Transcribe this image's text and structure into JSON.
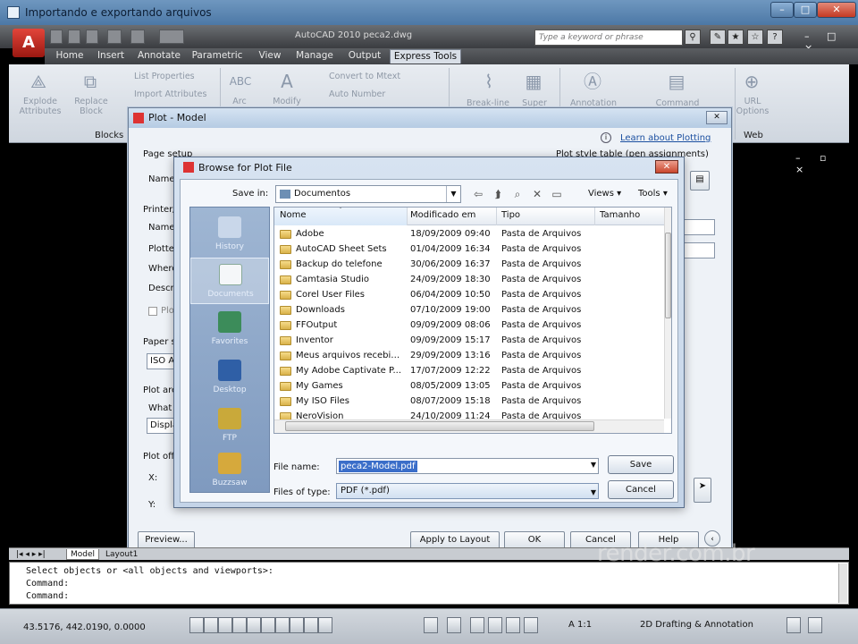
{
  "window": {
    "title": "Importando e exportando arquivos",
    "minimize": "–",
    "maximize": "□",
    "close": "✕"
  },
  "autocad": {
    "logo": "A",
    "title": "AutoCAD 2010    peca2.dwg",
    "search_placeholder": "Type a keyword or phrase",
    "window_controls": "– □ ×",
    "ribbon_tabs": [
      "Home",
      "Insert",
      "Annotate",
      "Parametric",
      "View",
      "Manage",
      "Output",
      "Express Tools"
    ],
    "active_tab": "Express Tools",
    "ribbon": {
      "explode": "Explode\nAttributes",
      "replace": "Replace\nBlock",
      "list_properties": "List Properties",
      "import_attributes": "Import Attributes",
      "arc": "Arc",
      "modify": "Modify",
      "convert_to_mtext": "Convert to Mtext",
      "auto_number": "Auto Number",
      "break_line": "Break-line",
      "super": "Super",
      "annotation": "Annotation",
      "command": "Command",
      "url_options": "URL\nOptions",
      "group_blocks": "Blocks",
      "group_web": "Web"
    },
    "doc_controls": "– ▫ ×",
    "layout_tabs": [
      "Model",
      "Layout1"
    ],
    "command_lines": [
      "Select objects or <all objects and viewports>:",
      "Command:",
      "Command:"
    ],
    "coords": "43.5176,  442.0190, 0.0000",
    "annotation_scale": "A 1:1",
    "workspace": "2D Drafting & Annotation"
  },
  "plot_dialog": {
    "title": "Plot - Model",
    "learn_link": "Learn about Plotting",
    "page_setup": "Page setup",
    "name_label": "Name:",
    "printer_label": "Printer/",
    "plotter_label": "Plotter",
    "where_label": "Where",
    "descr_label": "Descrip",
    "plot_to_file": "Plo",
    "paper_size": "Paper s",
    "paper_value": "ISO A",
    "plot_area": "Plot are",
    "what_to": "What t",
    "display": "Displa",
    "plot_offset": "Plot offs",
    "x_label": "X:",
    "y_label": "Y:",
    "style_table": "Plot style table (pen assignments)",
    "preview_btn": "Preview...",
    "apply_btn": "Apply to Layout",
    "ok_btn": "OK",
    "cancel_btn": "Cancel",
    "help_btn": "Help"
  },
  "browse": {
    "title": "Browse for Plot File",
    "save_in_label": "Save in:",
    "save_in_value": "Documentos",
    "views": "Views",
    "tools": "Tools",
    "places": [
      "History",
      "Documents",
      "Favorites",
      "Desktop",
      "FTP",
      "Buzzsaw"
    ],
    "columns": [
      "Nome",
      "Modificado em",
      "Tipo",
      "Tamanho"
    ],
    "files": [
      {
        "name": "Adobe",
        "date": "18/09/2009 09:40",
        "type": "Pasta de Arquivos"
      },
      {
        "name": "AutoCAD Sheet Sets",
        "date": "01/04/2009 16:34",
        "type": "Pasta de Arquivos"
      },
      {
        "name": "Backup do telefone",
        "date": "30/06/2009 16:37",
        "type": "Pasta de Arquivos"
      },
      {
        "name": "Camtasia Studio",
        "date": "24/09/2009 18:30",
        "type": "Pasta de Arquivos"
      },
      {
        "name": "Corel User Files",
        "date": "06/04/2009 10:50",
        "type": "Pasta de Arquivos"
      },
      {
        "name": "Downloads",
        "date": "07/10/2009 19:00",
        "type": "Pasta de Arquivos"
      },
      {
        "name": "FFOutput",
        "date": "09/09/2009 08:06",
        "type": "Pasta de Arquivos"
      },
      {
        "name": "Inventor",
        "date": "09/09/2009 15:17",
        "type": "Pasta de Arquivos"
      },
      {
        "name": "Meus arquivos recebid...",
        "date": "29/09/2009 13:16",
        "type": "Pasta de Arquivos"
      },
      {
        "name": "My Adobe Captivate P...",
        "date": "17/07/2009 12:22",
        "type": "Pasta de Arquivos"
      },
      {
        "name": "My Games",
        "date": "08/05/2009 13:05",
        "type": "Pasta de Arquivos"
      },
      {
        "name": "My ISO Files",
        "date": "08/07/2009 15:18",
        "type": "Pasta de Arquivos"
      },
      {
        "name": "NeroVision",
        "date": "24/10/2009 11:24",
        "type": "Pasta de Arquivos"
      }
    ],
    "file_name_label": "File name:",
    "file_name_value": "peca2-Model.pdf",
    "file_type_label": "Files of type:",
    "file_type_value": "PDF (*.pdf)",
    "save_btn": "Save",
    "cancel_btn": "Cancel"
  },
  "watermark": "render.com.br"
}
